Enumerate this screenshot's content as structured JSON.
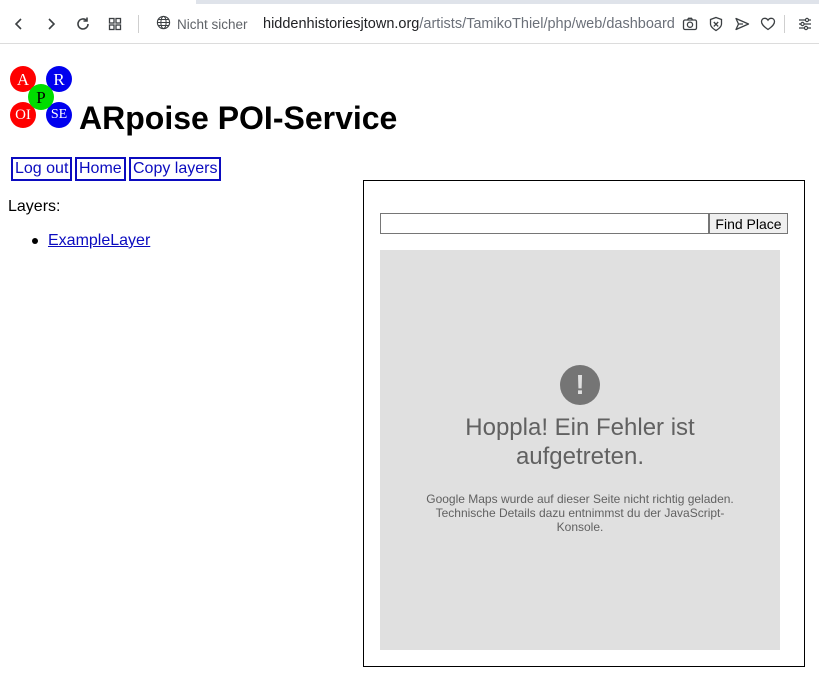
{
  "browser": {
    "security_label": "Nicht sicher",
    "url_host": "hiddenhistoriesjtown.org",
    "url_path": "/artists/TamikoThiel/php/web/dashboard"
  },
  "logo": {
    "letters": [
      "A",
      "R",
      "P",
      "OI",
      "SE"
    ],
    "colors": {
      "red": "#ff0000",
      "blue": "#0000ee",
      "green": "#00dd00"
    }
  },
  "page": {
    "title": "ARpoise POI-Service",
    "nav": [
      "Log out",
      "Home",
      "Copy layers"
    ],
    "layers_label": "Layers:",
    "layers": [
      "ExampleLayer"
    ]
  },
  "map": {
    "search_value": "",
    "find_button": "Find Place",
    "error_title": "Hoppla! Ein Fehler ist aufgetreten.",
    "error_description": "Google Maps wurde auf dieser Seite nicht richtig geladen. Technische Details dazu entnimmst du der JavaScript-Konsole."
  },
  "icons": [
    "back-icon",
    "forward-icon",
    "reload-icon",
    "tabs-grid-icon",
    "globe-icon",
    "camera-icon",
    "block-icon",
    "send-icon",
    "heart-icon",
    "settings-icon",
    "error-icon"
  ]
}
